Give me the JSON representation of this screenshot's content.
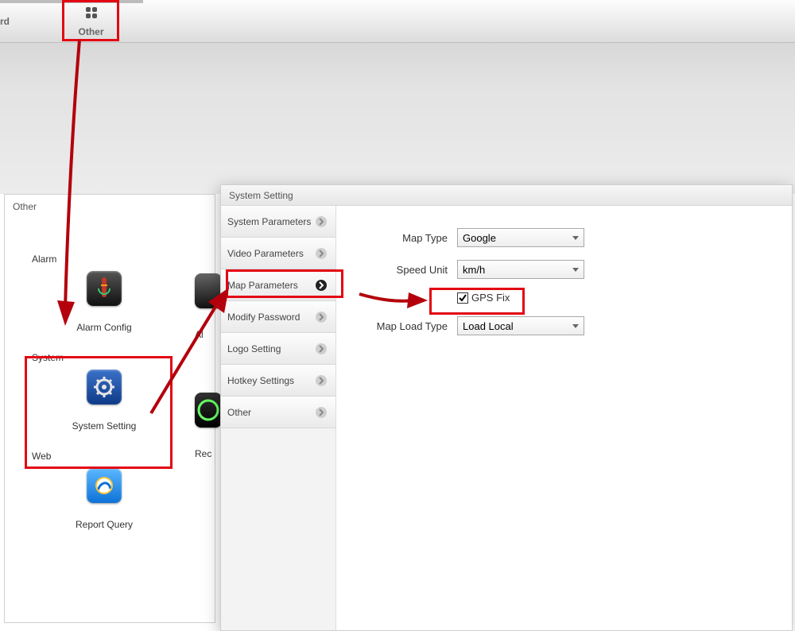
{
  "toolbar": {
    "tab_partial": "rd",
    "other_label": "Other"
  },
  "other_panel": {
    "title": "Other",
    "sections": {
      "alarm": {
        "title": "Alarm",
        "item_label": "Alarm Config",
        "peek_label": "Al"
      },
      "system": {
        "title": "System",
        "item_label": "System Setting",
        "peek_label": "Rec"
      },
      "web": {
        "title": "Web",
        "item_label": "Report Query"
      }
    }
  },
  "system_setting": {
    "title": "System Setting",
    "sidebar": [
      {
        "label": "System Parameters"
      },
      {
        "label": "Video Parameters"
      },
      {
        "label": "Map Parameters",
        "active": true
      },
      {
        "label": "Modify Password"
      },
      {
        "label": "Logo Setting"
      },
      {
        "label": "Hotkey Settings"
      },
      {
        "label": "Other"
      }
    ],
    "form": {
      "map_type": {
        "label": "Map Type",
        "value": "Google"
      },
      "speed_unit": {
        "label": "Speed Unit",
        "value": "km/h"
      },
      "gps_fix": {
        "label": "GPS Fix",
        "checked": true
      },
      "map_load_type": {
        "label": "Map Load Type",
        "value": "Load Local"
      }
    }
  }
}
